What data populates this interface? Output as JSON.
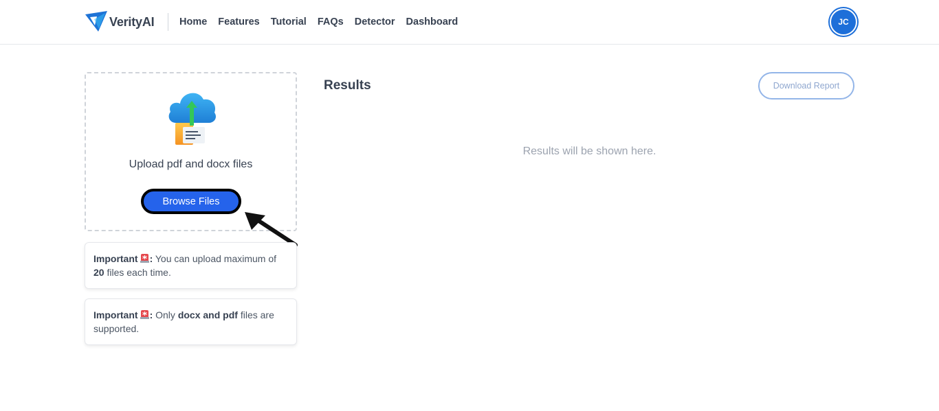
{
  "header": {
    "brand_name": "VerityAI",
    "nav": [
      {
        "label": "Home"
      },
      {
        "label": "Features"
      },
      {
        "label": "Tutorial"
      },
      {
        "label": "FAQs"
      },
      {
        "label": "Detector"
      },
      {
        "label": "Dashboard"
      }
    ],
    "avatar_initials": "JC"
  },
  "upload": {
    "icon": "cloud-upload-document-icon",
    "instruction": "Upload pdf and docx files",
    "browse_label": "Browse Files",
    "pointer": "arrow-pointer-icon"
  },
  "notes": [
    {
      "label": "Important",
      "icon": "siren-icon",
      "text_before": "You can upload maximum of",
      "bold": "20",
      "text_after": "files each time."
    },
    {
      "label": "Important",
      "icon": "siren-icon",
      "text_before": "Only",
      "bold": "docx and pdf",
      "text_after": "files are supported."
    }
  ],
  "results": {
    "title": "Results",
    "download_label": "Download Report",
    "empty_message": "Results will be shown here."
  },
  "colors": {
    "primary": "#2563eb",
    "avatar": "#1d6fd9",
    "download_border": "#93b5e8",
    "muted_text": "#9ca3af"
  }
}
